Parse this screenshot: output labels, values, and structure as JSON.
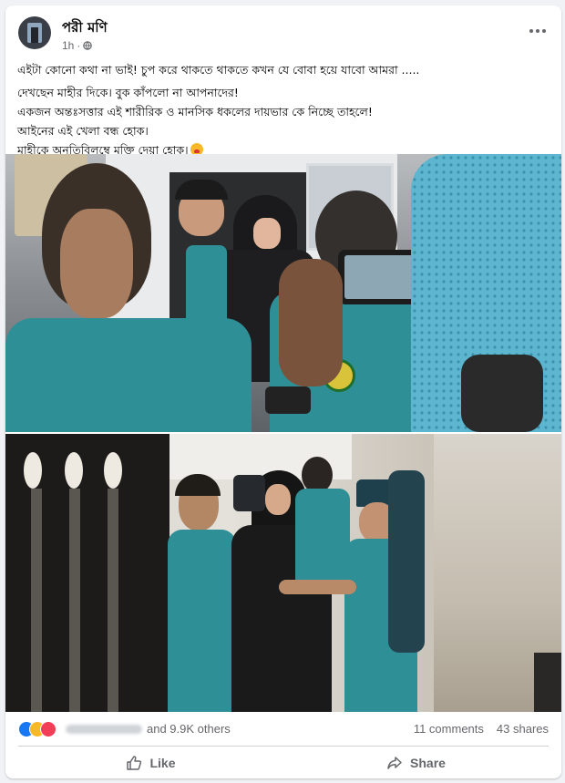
{
  "post": {
    "author": "পরী মণি",
    "time": "1h",
    "privacy_icon": "globe-icon",
    "text_lines": [
      "এইটা কোনো কথা না ভাই! চুপ করে থাকতে থাকতে কখন যে বোবা হয়ে যাবো আমরা .....",
      "দেখছেন মাহীর দিকে। বুক কাঁপলো না আপনাদের!",
      "একজন অন্তঃসত্তার এই শারীরিক ও মানসিক ধকলের দায়ভার কে নিচ্ছে তাহলে!",
      "আইনের এই খেলা বন্ধ হোক।",
      "মাহীকে অনতিবিলম্বে মুক্তি দেয়া হোক।"
    ]
  },
  "engagement": {
    "others_text": "and 9.9K others",
    "comments": "11 comments",
    "shares": "43 shares",
    "reaction_icons": [
      "like-icon",
      "care-icon",
      "love-icon"
    ]
  },
  "actions": {
    "like": "Like",
    "share": "Share"
  },
  "colors": {
    "accent": "#1877f2",
    "police_uniform": "#2f8f97",
    "text_secondary": "#65676b"
  }
}
